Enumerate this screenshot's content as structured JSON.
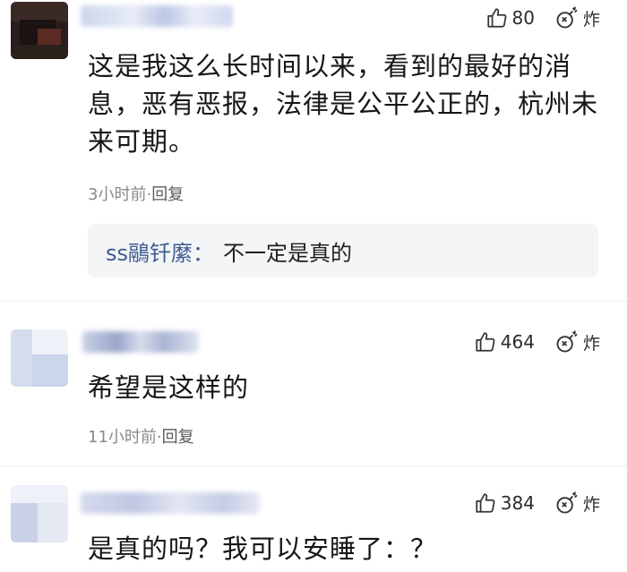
{
  "comments": [
    {
      "likes": "80",
      "bomb_label": "炸",
      "text": "这是我这么长时间以来，看到的最好的消息，恶有恶报，法律是公平公正的，杭州未来可期。",
      "time": "3小时前",
      "separator": "·",
      "reply_label": "回复",
      "reply": {
        "user": "ss鷊钎縻",
        "colon": "：",
        "text": "不一定是真的"
      }
    },
    {
      "likes": "464",
      "bomb_label": "炸",
      "text": "希望是这样的",
      "time": "11小时前",
      "separator": "·",
      "reply_label": "回复"
    },
    {
      "likes": "384",
      "bomb_label": "炸",
      "text": "是真的吗？我可以安睡了：？"
    }
  ],
  "icons": {
    "like": "thumbs-up-icon",
    "bomb": "bomb-icon"
  },
  "colors": {
    "reply_user": "#3e5b91",
    "meta_text": "#8a8a8a",
    "reply_bg": "#f4f5f7"
  }
}
